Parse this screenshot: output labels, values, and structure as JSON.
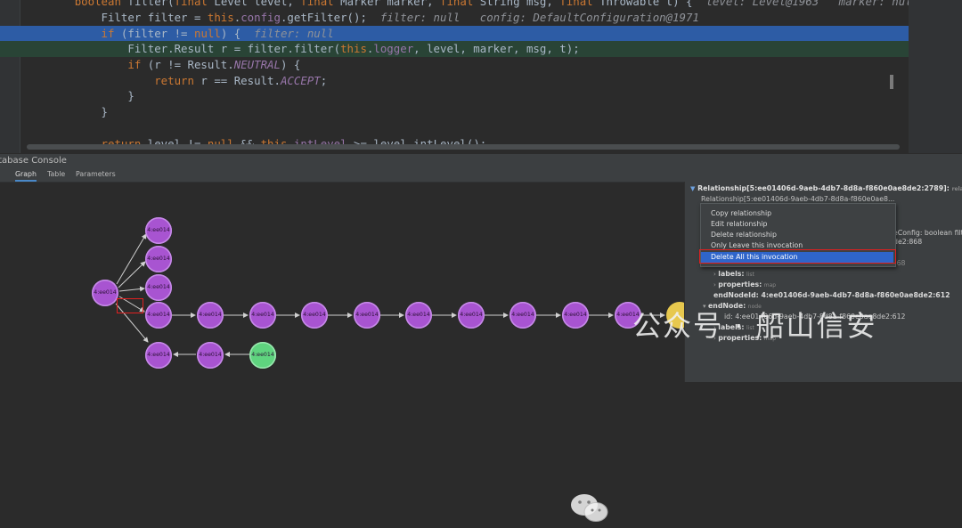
{
  "editor": {
    "lines": [
      [
        {
          "t": "        ",
          "c": ""
        },
        {
          "t": "boolean ",
          "c": "kw"
        },
        {
          "t": "filter(",
          "c": ""
        },
        {
          "t": "final ",
          "c": "kw"
        },
        {
          "t": "Level level, ",
          "c": ""
        },
        {
          "t": "final ",
          "c": "kw"
        },
        {
          "t": "Marker marker, ",
          "c": ""
        },
        {
          "t": "final ",
          "c": "kw"
        },
        {
          "t": "String msg, ",
          "c": ""
        },
        {
          "t": "final ",
          "c": "kw"
        },
        {
          "t": "Throwable t) {  ",
          "c": ""
        },
        {
          "t": "level: Level@1963   marker: null   msg: \"dde",
          "c": "cm"
        }
      ],
      [
        {
          "t": "            Filter filter = ",
          "c": ""
        },
        {
          "t": "this",
          "c": "th"
        },
        {
          "t": ".",
          "c": ""
        },
        {
          "t": "config",
          "c": "fld"
        },
        {
          "t": ".getFilter();  ",
          "c": ""
        },
        {
          "t": "filter: null   config: DefaultConfiguration@1971",
          "c": "cm"
        }
      ],
      [
        {
          "t": "            ",
          "c": ""
        },
        {
          "t": "if ",
          "c": "kw"
        },
        {
          "t": "(filter != ",
          "c": ""
        },
        {
          "t": "null",
          "c": "kw"
        },
        {
          "t": ") {  ",
          "c": ""
        },
        {
          "t": "filter: null",
          "c": "cm"
        }
      ],
      [
        {
          "t": "                Filter.Result r = filter.filter(",
          "c": ""
        },
        {
          "t": "this",
          "c": "th"
        },
        {
          "t": ".",
          "c": ""
        },
        {
          "t": "logger",
          "c": "fld"
        },
        {
          "t": ", level, marker, msg, t);",
          "c": ""
        }
      ],
      [
        {
          "t": "                ",
          "c": ""
        },
        {
          "t": "if ",
          "c": "kw"
        },
        {
          "t": "(r != Result.",
          "c": ""
        },
        {
          "t": "NEUTRAL",
          "c": "const"
        },
        {
          "t": ") {",
          "c": ""
        }
      ],
      [
        {
          "t": "                    ",
          "c": ""
        },
        {
          "t": "return ",
          "c": "kw"
        },
        {
          "t": "r == Result.",
          "c": ""
        },
        {
          "t": "ACCEPT",
          "c": "const"
        },
        {
          "t": ";",
          "c": ""
        }
      ],
      [
        {
          "t": "                }",
          "c": ""
        }
      ],
      [
        {
          "t": "            }",
          "c": ""
        }
      ],
      [
        {
          "t": "",
          "c": ""
        }
      ],
      [
        {
          "t": "            ",
          "c": ""
        },
        {
          "t": "return ",
          "c": "kw"
        },
        {
          "t": "level != ",
          "c": ""
        },
        {
          "t": "null ",
          "c": "kw"
        },
        {
          "t": "&& ",
          "c": ""
        },
        {
          "t": "this",
          "c": "th"
        },
        {
          "t": ".",
          "c": ""
        },
        {
          "t": "intLevel ",
          "c": "fld"
        },
        {
          "t": ">= level.intLevel();",
          "c": ""
        }
      ]
    ]
  },
  "console": {
    "title": "atabase Console",
    "tabs": [
      "Graph",
      "Table",
      "Parameters"
    ]
  },
  "graph": {
    "node_label": "4:ee014",
    "nodes_count_visible": 19
  },
  "panel": {
    "header": "Relationship[5:ee01406d-9aeb-4db7-8d8a-f860e0ae8de2:2789]:",
    "header_type": "relation",
    "subheader": "Relationship[5:ee01406d-9aeb-4db7-8d8a-f860e0ae8...",
    "behind": {
      "config_text": "eConfig: boolean filt",
      "id_tail": "de2:868",
      "id_row": "id: 4:ee01406d-9aeb-4db7-8d8a-f860e0ae8de2:868",
      "labels": "labels:",
      "labels_type": "list",
      "properties": "properties:",
      "properties_type": "map",
      "end_node_id": "endNodeId: 4:ee01406d-9aeb-4db7-8d8a-f860e0ae8de2:612",
      "end_node": "endNode:",
      "end_node_type": "node",
      "end_id": "id: 4:ee01406d-9aeb-4db7-8d8a-f860e0ae8de2:612",
      "end_labels": "labels:",
      "end_labels_type": "list",
      "end_properties": "properties:",
      "end_properties_type": "map"
    }
  },
  "context_menu": {
    "items": [
      "Copy relationship",
      "Edit relationship",
      "Delete relationship",
      "Only Leave this invocation",
      "Delete All this invocation"
    ],
    "active_index": 4
  },
  "watermark": {
    "text": "公众号 · 船山信安"
  },
  "colors": {
    "node_purple": "#a854d1",
    "node_green": "#5fd47f",
    "node_yellow": "#e7c84e",
    "highlight_blue": "#2d5ca5",
    "highlight_green": "#294436",
    "menu_active": "#2f65ca",
    "red_box": "#e02020"
  }
}
